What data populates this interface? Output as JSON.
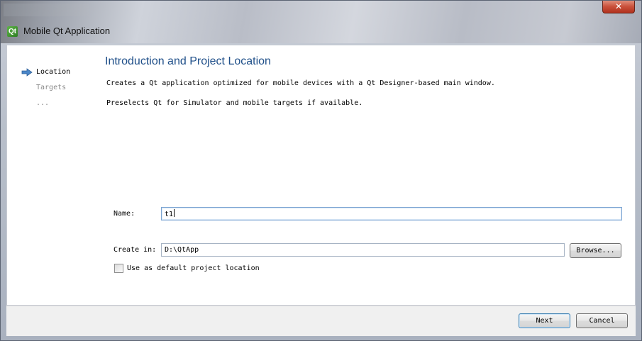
{
  "window": {
    "title": "Mobile Qt Application",
    "icon": "qt-creator-icon",
    "close_glyph": "✕"
  },
  "sidebar": {
    "items": [
      {
        "label": "Location",
        "state": "active"
      },
      {
        "label": "Targets",
        "state": "inactive"
      },
      {
        "label": "...",
        "state": "inactive"
      }
    ]
  },
  "page": {
    "heading": "Introduction and Project Location",
    "description_1": "Creates a Qt application optimized for mobile devices with a Qt Designer-based main window.",
    "description_2": "Preselects Qt for Simulator and mobile targets if available."
  },
  "form": {
    "name_label": "Name:",
    "name_value": "t1",
    "create_in_label": "Create in:",
    "create_in_value": "D:\\QtApp",
    "browse_label": "Browse...",
    "default_location_label": "Use as default project location",
    "default_location_checked": false
  },
  "footer": {
    "next_label": "Next",
    "cancel_label": "Cancel"
  },
  "colors": {
    "heading": "#1f4f89",
    "arrow": "#4a86c8",
    "close": "#c9503a"
  }
}
